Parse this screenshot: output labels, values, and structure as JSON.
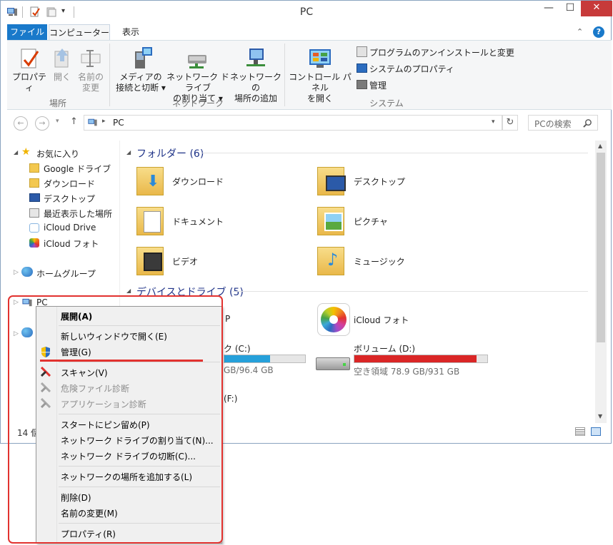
{
  "window": {
    "title": "PC"
  },
  "ribbon": {
    "tabs": [
      "ファイル",
      "コンピューター",
      "表示"
    ],
    "groups": {
      "location": {
        "label": "場所",
        "buttons": [
          {
            "label1": "プロパティ",
            "label2": "",
            "enabled": true
          },
          {
            "label1": "開く",
            "label2": "",
            "enabled": false
          },
          {
            "label1": "名前の",
            "label2": "変更",
            "enabled": false
          }
        ]
      },
      "network": {
        "label": "ネットワーク",
        "buttons": [
          {
            "label1": "メディアの",
            "label2": "接続と切断 ▾"
          },
          {
            "label1": "ネットワーク ドライブ",
            "label2": "の割り当て ▾"
          },
          {
            "label1": "ネットワークの",
            "label2": "場所の追加"
          }
        ]
      },
      "system": {
        "label": "システム",
        "control_panel": {
          "label1": "コントロール パネル",
          "label2": "を開く"
        },
        "small_buttons": [
          "プログラムのアンインストールと変更",
          "システムのプロパティ",
          "管理"
        ]
      }
    }
  },
  "address": {
    "path": "PC",
    "search_placeholder": "PCの検索"
  },
  "nav": {
    "favorites": "お気に入り",
    "favorite_items": [
      "Google ドライブ",
      "ダウンロード",
      "デスクトップ",
      "最近表示した場所",
      "iCloud Drive",
      "iCloud フォト"
    ],
    "homegroup": "ホームグループ",
    "pc": "PC"
  },
  "content": {
    "folders_header": "フォルダー (6)",
    "folders": [
      "ダウンロード",
      "デスクトップ",
      "ドキュメント",
      "ピクチャ",
      "ビデオ",
      "ミュージック"
    ],
    "devices_header": "デバイスとドライブ (5)",
    "partial_p": "P",
    "icloud_photos": "iCloud フォト",
    "drive_c": {
      "name_fragment": "ク (C:)",
      "space_fragment": "GB/96.4 GB",
      "used_fraction": 0.57
    },
    "drive_d": {
      "name": "ボリューム (D:)",
      "space": "空き領域 78.9 GB/931 GB",
      "used_fraction": 0.92
    },
    "drive_f": "(F:)"
  },
  "status": {
    "count": "14 個"
  },
  "context_menu": {
    "items": [
      {
        "label": "展開(A)",
        "bold": true
      },
      {
        "label": "新しいウィンドウで開く(E)"
      },
      {
        "label": "管理(G)"
      },
      {
        "label": "スキャン(V)"
      },
      {
        "label": "危険ファイル診断",
        "disabled": true
      },
      {
        "label": "アプリケーション診断",
        "disabled": true
      },
      {
        "label": "スタートにピン留め(P)"
      },
      {
        "label": "ネットワーク ドライブの割り当て(N)..."
      },
      {
        "label": "ネットワーク ドライブの切断(C)..."
      },
      {
        "label": "ネットワークの場所を追加する(L)"
      },
      {
        "label": "削除(D)"
      },
      {
        "label": "名前の変更(M)"
      },
      {
        "label": "プロパティ(R)"
      }
    ]
  },
  "colors": {
    "accent": "#1979ca",
    "drive_bar_normal": "#26a0da",
    "drive_bar_full": "#da2626",
    "highlight": "#e2322f"
  }
}
